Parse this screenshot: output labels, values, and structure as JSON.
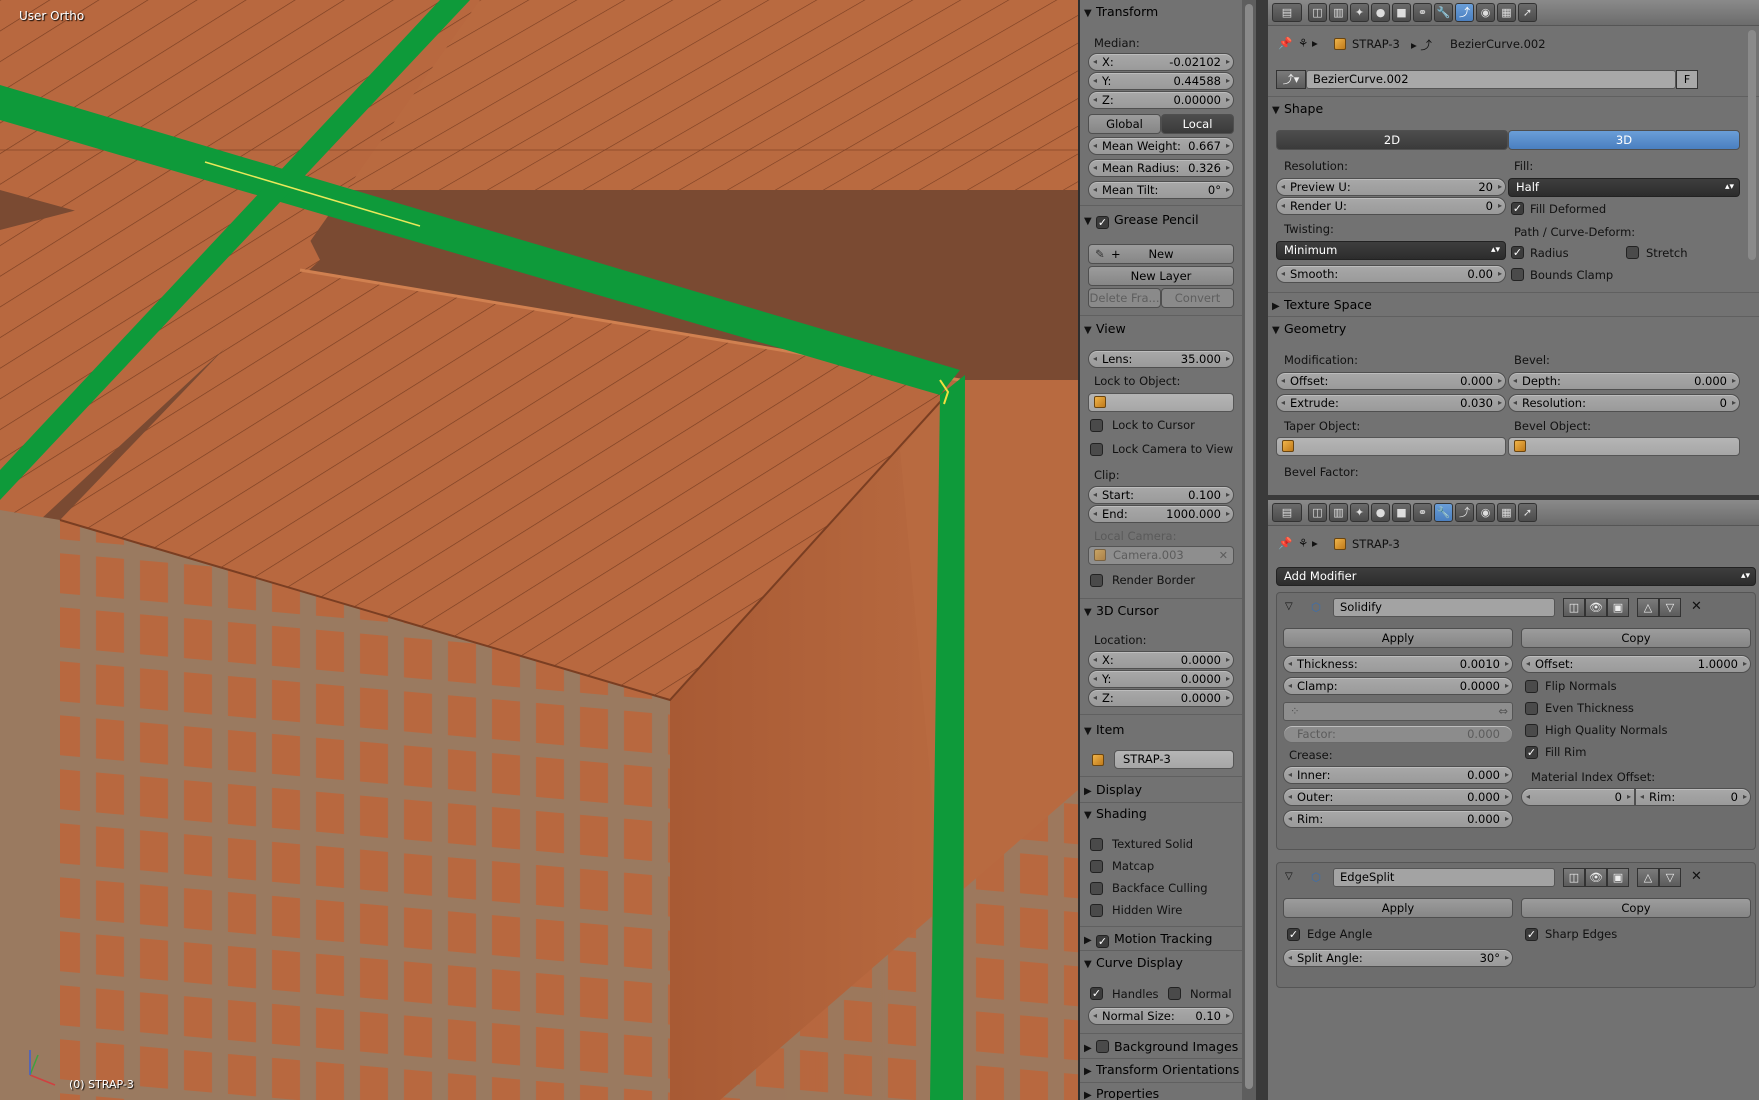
{
  "viewport": {
    "view_name": "User Ortho",
    "object_status": "(0) STRAP-3",
    "axis_labels": [
      "z",
      "y",
      "x"
    ]
  },
  "npanel": {
    "transform": {
      "title": "Transform",
      "median_label": "Median:",
      "x": {
        "label": "X:",
        "value": "-0.02102"
      },
      "y": {
        "label": "Y:",
        "value": "0.44588"
      },
      "z": {
        "label": "Z:",
        "value": "0.00000"
      },
      "global": "Global",
      "local": "Local",
      "mean_weight": {
        "label": "Mean Weight:",
        "value": "0.667"
      },
      "mean_radius": {
        "label": "Mean Radius:",
        "value": "0.326"
      },
      "mean_tilt": {
        "label": "Mean Tilt:",
        "value": "0°"
      }
    },
    "grease_pencil": {
      "title": "Grease Pencil",
      "new": "New",
      "new_layer": "New Layer",
      "delete_frame": "Delete Fra...",
      "convert": "Convert"
    },
    "view": {
      "title": "View",
      "lens": {
        "label": "Lens:",
        "value": "35.000"
      },
      "lock_to_object": "Lock to Object:",
      "lock_to_cursor": "Lock to Cursor",
      "lock_camera": "Lock Camera to View",
      "clip": "Clip:",
      "start": {
        "label": "Start:",
        "value": "0.100"
      },
      "end": {
        "label": "End:",
        "value": "1000.000"
      },
      "local_camera": "Local Camera:",
      "camera": "Camera.003",
      "render_border": "Render Border"
    },
    "cursor": {
      "title": "3D Cursor",
      "location": "Location:",
      "x": {
        "label": "X:",
        "value": "0.0000"
      },
      "y": {
        "label": "Y:",
        "value": "0.0000"
      },
      "z": {
        "label": "Z:",
        "value": "0.0000"
      }
    },
    "item": {
      "title": "Item",
      "name": "STRAP-3"
    },
    "display": "Display",
    "shading": {
      "title": "Shading",
      "textured_solid": "Textured Solid",
      "matcap": "Matcap",
      "backface_culling": "Backface Culling",
      "hidden_wire": "Hidden Wire"
    },
    "motion_tracking": "Motion Tracking",
    "curve_display": {
      "title": "Curve Display",
      "handles": "Handles",
      "normal": "Normal",
      "normal_size": {
        "label": "Normal Size:",
        "value": "0.10"
      }
    },
    "background_images": "Background Images",
    "transform_orientations": "Transform Orientations",
    "properties": "Properties"
  },
  "props": {
    "breadcrumb": {
      "object": "STRAP-3",
      "data": "BezierCurve.002"
    },
    "datablock": {
      "name": "BezierCurve.002",
      "fake_user": "F"
    },
    "shape": {
      "title": "Shape",
      "mode_2d": "2D",
      "mode_3d": "3D",
      "resolution": "Resolution:",
      "preview_u": {
        "label": "Preview U:",
        "value": "20"
      },
      "render_u": {
        "label": "Render U:",
        "value": "0"
      },
      "fill": "Fill:",
      "fill_value": "Half",
      "fill_deformed": "Fill Deformed",
      "twisting": "Twisting:",
      "twisting_value": "Minimum",
      "smooth": {
        "label": "Smooth:",
        "value": "0.00"
      },
      "path_deform": "Path / Curve-Deform:",
      "radius": "Radius",
      "stretch": "Stretch",
      "bounds_clamp": "Bounds Clamp"
    },
    "texture_space": "Texture Space",
    "geometry": {
      "title": "Geometry",
      "modification": "Modification:",
      "offset": {
        "label": "Offset:",
        "value": "0.000"
      },
      "extrude": {
        "label": "Extrude:",
        "value": "0.030"
      },
      "taper_object": "Taper Object:",
      "bevel": "Bevel:",
      "depth": {
        "label": "Depth:",
        "value": "0.000"
      },
      "resolution": {
        "label": "Resolution:",
        "value": "0"
      },
      "bevel_object": "Bevel Object:",
      "bevel_factor": "Bevel Factor:"
    }
  },
  "modifiers": {
    "breadcrumb": {
      "object": "STRAP-3"
    },
    "add_modifier": "Add Modifier",
    "solidify": {
      "name": "Solidify",
      "apply": "Apply",
      "copy": "Copy",
      "thickness": {
        "label": "Thickness:",
        "value": "0.0010"
      },
      "clamp": {
        "label": "Clamp:",
        "value": "0.0000"
      },
      "offset": {
        "label": "Offset:",
        "value": "1.0000"
      },
      "flip_normals": "Flip Normals",
      "even_thickness": "Even Thickness",
      "high_quality_normals": "High Quality Normals",
      "fill_rim": "Fill Rim",
      "factor": {
        "label": "Factor:",
        "value": "0.000"
      },
      "crease": "Crease:",
      "inner": {
        "label": "Inner:",
        "value": "0.000"
      },
      "outer": {
        "label": "Outer:",
        "value": "0.000"
      },
      "rim": {
        "label": "Rim:",
        "value": "0.000"
      },
      "material_index_offset": "Material Index Offset:",
      "mat_offset": {
        "value": "0"
      },
      "mat_rim": {
        "label": "Rim:",
        "value": "0"
      }
    },
    "edgesplit": {
      "name": "EdgeSplit",
      "apply": "Apply",
      "copy": "Copy",
      "edge_angle": "Edge Angle",
      "sharp_edges": "Sharp Edges",
      "split_angle": {
        "label": "Split Angle:",
        "value": "30°"
      }
    }
  },
  "colors": {
    "brick": "#b8683f",
    "strap": "#0e9a3a",
    "panel": "#727272",
    "accent": "#4a7fc0"
  }
}
